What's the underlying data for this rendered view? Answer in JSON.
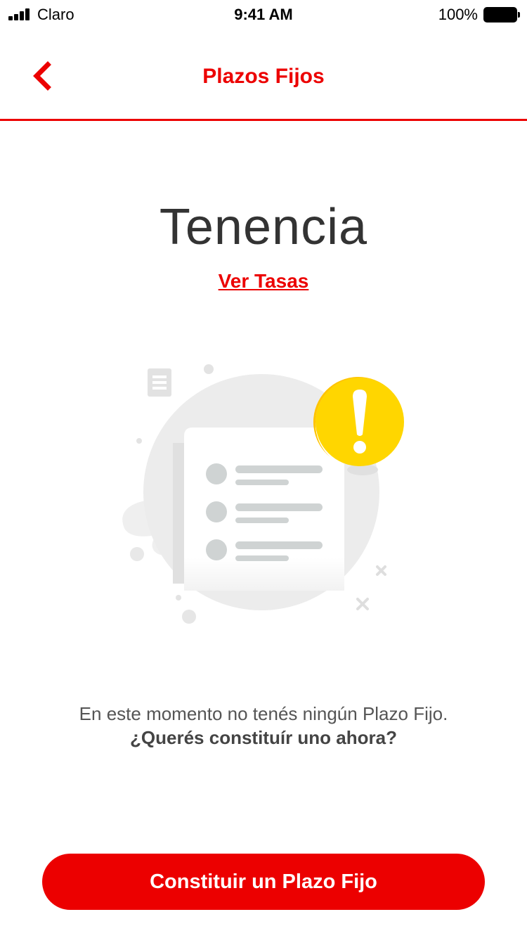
{
  "status_bar": {
    "carrier": "Claro",
    "time": "9:41 AM",
    "battery": "100%"
  },
  "header": {
    "title": "Plazos Fijos",
    "back_icon": "chevron-left-icon"
  },
  "main": {
    "title": "Tenencia",
    "rates_link": "Ver Tasas",
    "empty_message": "En este momento no tenés ningún Plazo Fijo.",
    "question": "¿Querés constituír uno ahora?",
    "illustration_icons": [
      "document-list-icon",
      "warning-icon"
    ]
  },
  "footer": {
    "button_label": "Constituir un Plazo Fijo"
  },
  "colors": {
    "accent": "#ec0000",
    "warning": "#ffd600"
  }
}
